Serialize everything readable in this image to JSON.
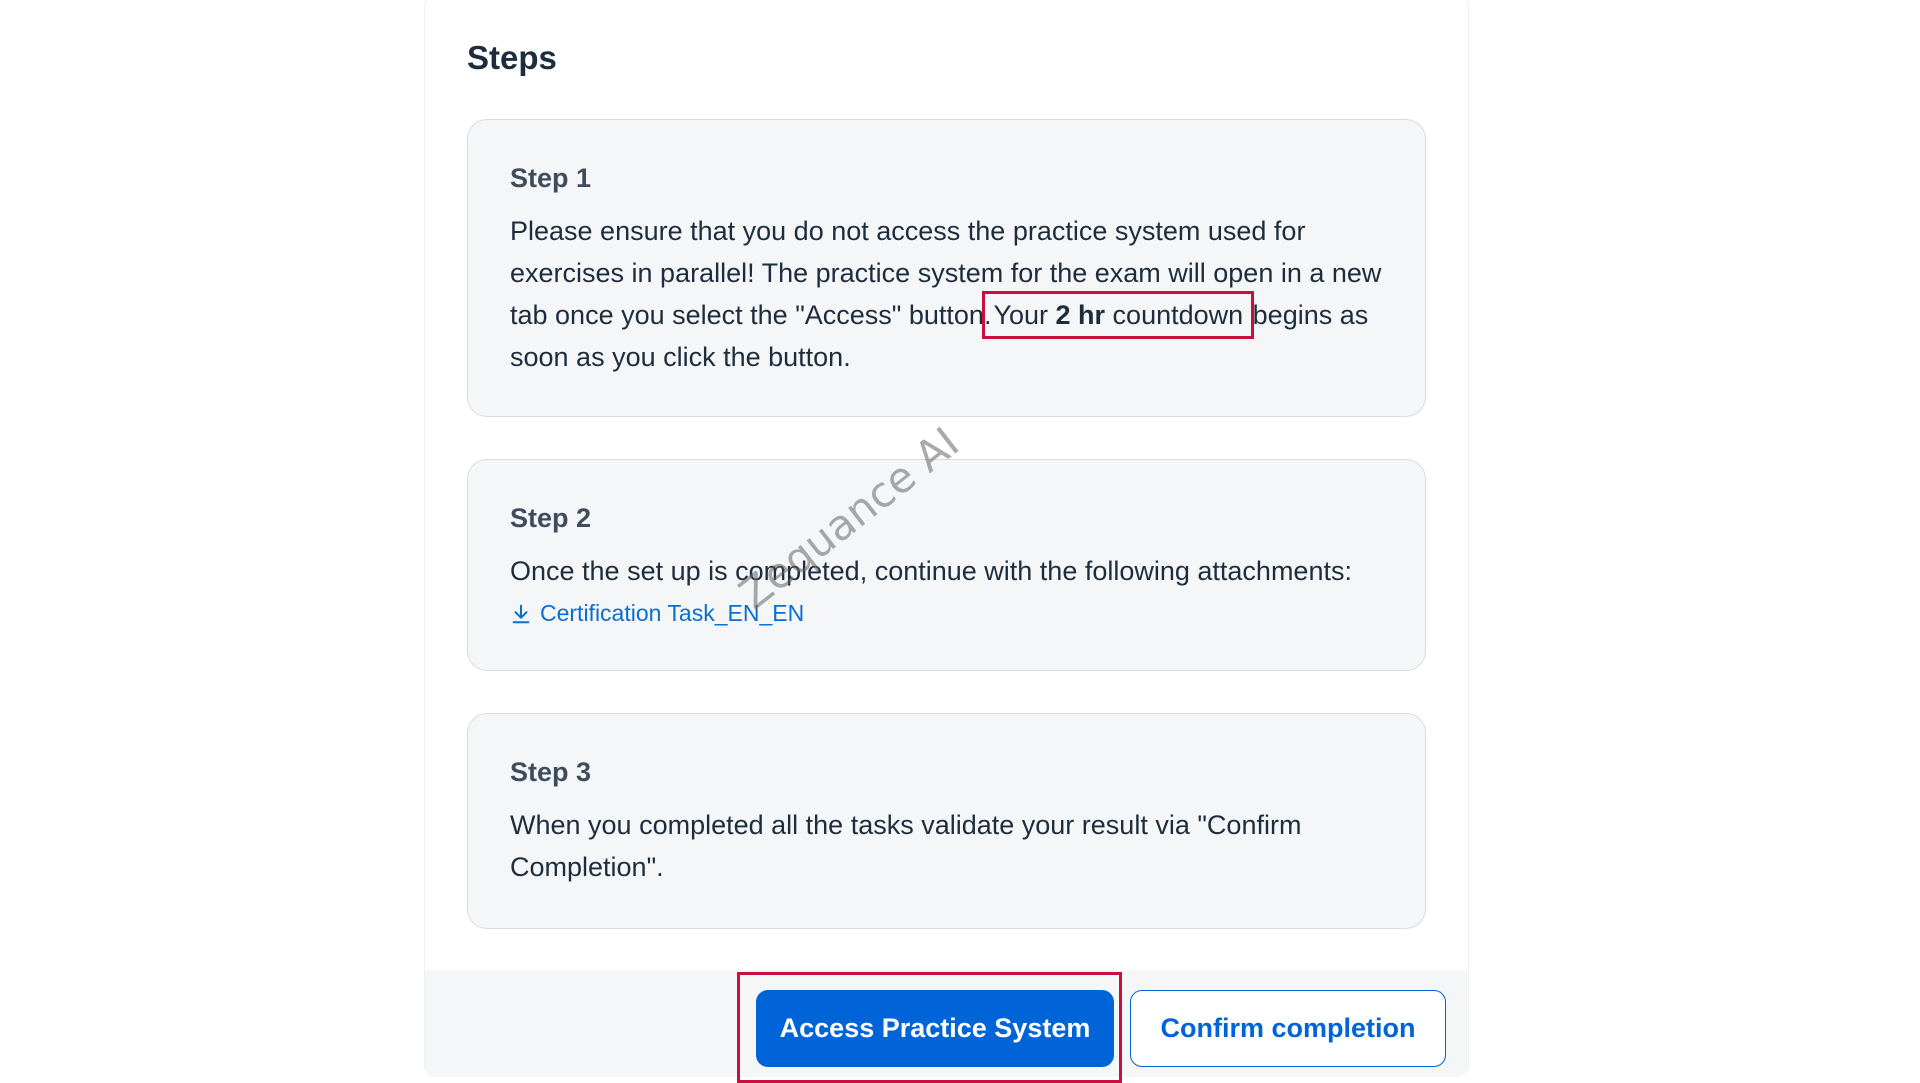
{
  "section": {
    "title": "Steps"
  },
  "steps": [
    {
      "title": "Step 1",
      "body_part1": "Please ensure that you do not access the practice system used for exercises in parallel! The practice system for the exam will open in a new tab once you select the \"Access\" button.",
      "body_highlight_prefix": "Your ",
      "body_highlight_bold": "2 hr",
      "body_highlight_suffix": " countdown",
      "body_part2": " begins as soon as you click the button."
    },
    {
      "title": "Step 2",
      "body": "Once the set up is completed, continue with the following attachments:",
      "attachment_label": "Certification Task_EN_EN",
      "attachment_icon": "download-icon"
    },
    {
      "title": "Step 3",
      "body": "When you completed all the tasks validate your result via \"Confirm Completion\"."
    }
  ],
  "watermark": "Zequance AI",
  "footer": {
    "primary_label": "Access Practice System",
    "secondary_label": "Confirm completion"
  },
  "colors": {
    "accent": "#0064d9",
    "highlight": "#c8103e",
    "link": "#0a6ed1"
  }
}
